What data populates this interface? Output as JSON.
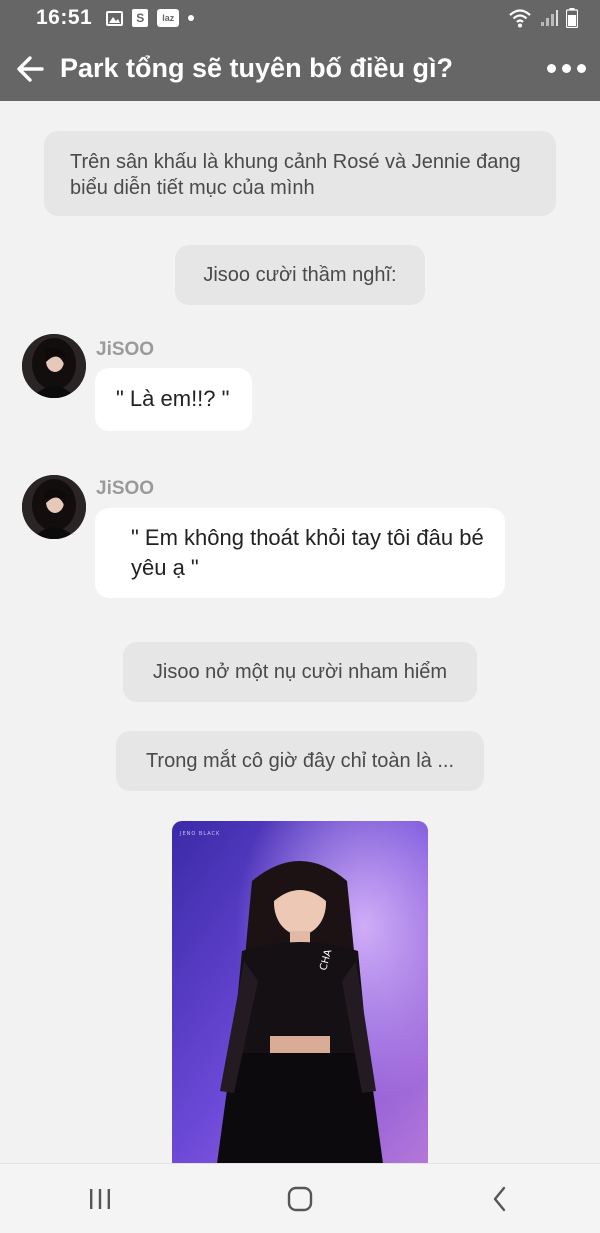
{
  "status_bar": {
    "time": "16:51",
    "icons": [
      "gallery-icon",
      "shopee-icon",
      "lazada-icon",
      "dot-icon",
      "wifi-icon",
      "signal-icon",
      "battery-icon"
    ],
    "lazada_label": "laz",
    "shopee_label": "S"
  },
  "header": {
    "title": "Park tổng sẽ tuyên bố điều gì?",
    "back_icon": "back-arrow-icon",
    "more_icon": "more-options-icon"
  },
  "messages": [
    {
      "type": "narration",
      "text": "Trên sân khấu là khung cảnh Rosé và Jennie đang biểu diễn tiết mục của mình"
    },
    {
      "type": "narration",
      "text": "Jisoo cười thầm nghĩ:"
    },
    {
      "type": "character",
      "sender": "JiSOO",
      "text": "\" Là em!!? \""
    },
    {
      "type": "character",
      "sender": "JiSOO",
      "text": "\" Em không thoát khỏi tay tôi đâu bé yêu ạ \""
    },
    {
      "type": "narration",
      "text": "Jisoo nở một nụ cười nham hiểm"
    },
    {
      "type": "narration",
      "text": "Trong mắt cô giờ đây chỉ toàn là ..."
    },
    {
      "type": "image",
      "caption": "JENO BLACK",
      "shirt_text": "CHA"
    }
  ],
  "nav_bar": {
    "icons": [
      "recent-apps-icon",
      "home-icon",
      "back-icon"
    ]
  },
  "colors": {
    "header_bg": "#666666",
    "chat_bg": "#f2f2f2",
    "narration_bg": "#e6e6e6",
    "bubble_bg": "#ffffff",
    "sender_color": "#9a9a9a"
  }
}
